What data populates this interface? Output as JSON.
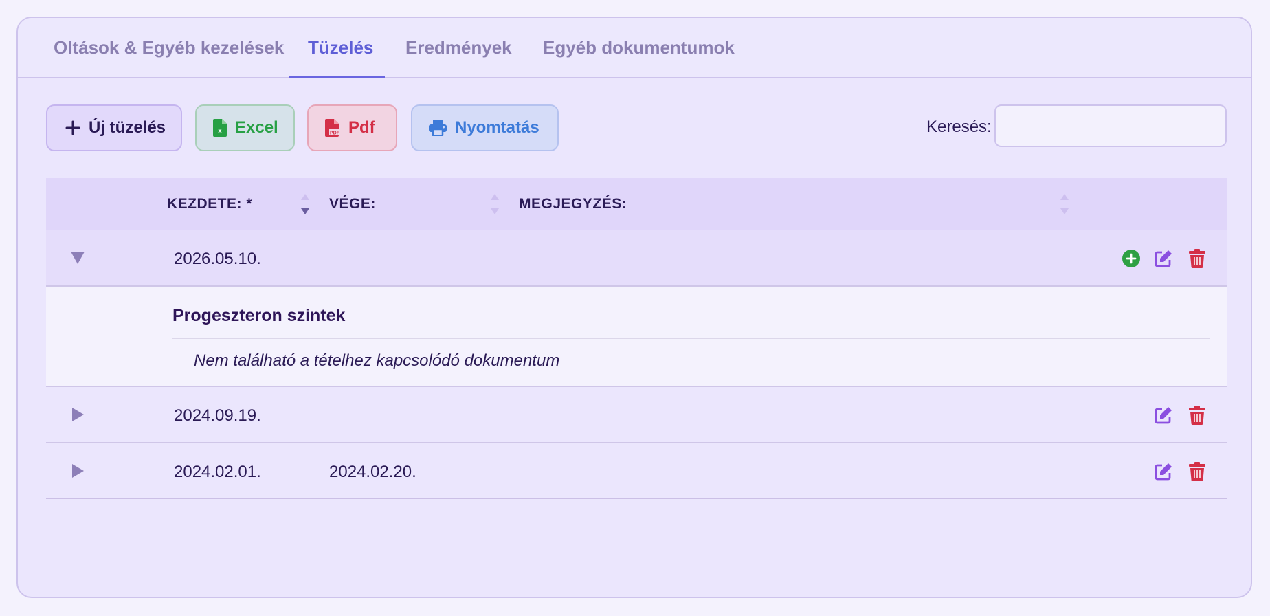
{
  "tabs": [
    {
      "label": "Oltások & Egyéb kezelések",
      "active": false
    },
    {
      "label": "Tüzelés",
      "active": true
    },
    {
      "label": "Eredmények",
      "active": false
    },
    {
      "label": "Egyéb dokumentumok",
      "active": false
    }
  ],
  "toolbar": {
    "new_label": "Új tüzelés",
    "excel_label": "Excel",
    "pdf_label": "Pdf",
    "print_label": "Nyomtatás"
  },
  "search": {
    "label": "Keresés:",
    "value": "",
    "placeholder": ""
  },
  "table": {
    "columns": [
      "KEZDETE: *",
      "VÉGE:",
      "MEGJEGYZÉS:"
    ],
    "rows": [
      {
        "start": "2026.05.10.",
        "end": "",
        "note": "",
        "expanded": true
      },
      {
        "start": "2024.09.19.",
        "end": "",
        "note": "",
        "expanded": false
      },
      {
        "start": "2024.02.01.",
        "end": "2024.02.20.",
        "note": "",
        "expanded": false
      }
    ],
    "detail": {
      "title": "Progeszteron szintek",
      "empty_text": "Nem található a tételhez kapcsolódó dokumentum"
    }
  },
  "colors": {
    "accent": "#5e5ed6",
    "excel": "#27a044",
    "pdf": "#d42f47",
    "print": "#3d7bd9",
    "edit": "#8b4fe0",
    "delete": "#d42f47",
    "add": "#2ea043"
  },
  "icons": {
    "new": "plus-icon",
    "excel": "excel-file-icon",
    "pdf": "pdf-file-icon",
    "print": "printer-icon",
    "add": "plus-circle-icon",
    "edit": "edit-icon",
    "delete": "trash-icon",
    "expand": "caret-right-icon",
    "collapse": "caret-down-icon",
    "sort": "sort-icon"
  }
}
